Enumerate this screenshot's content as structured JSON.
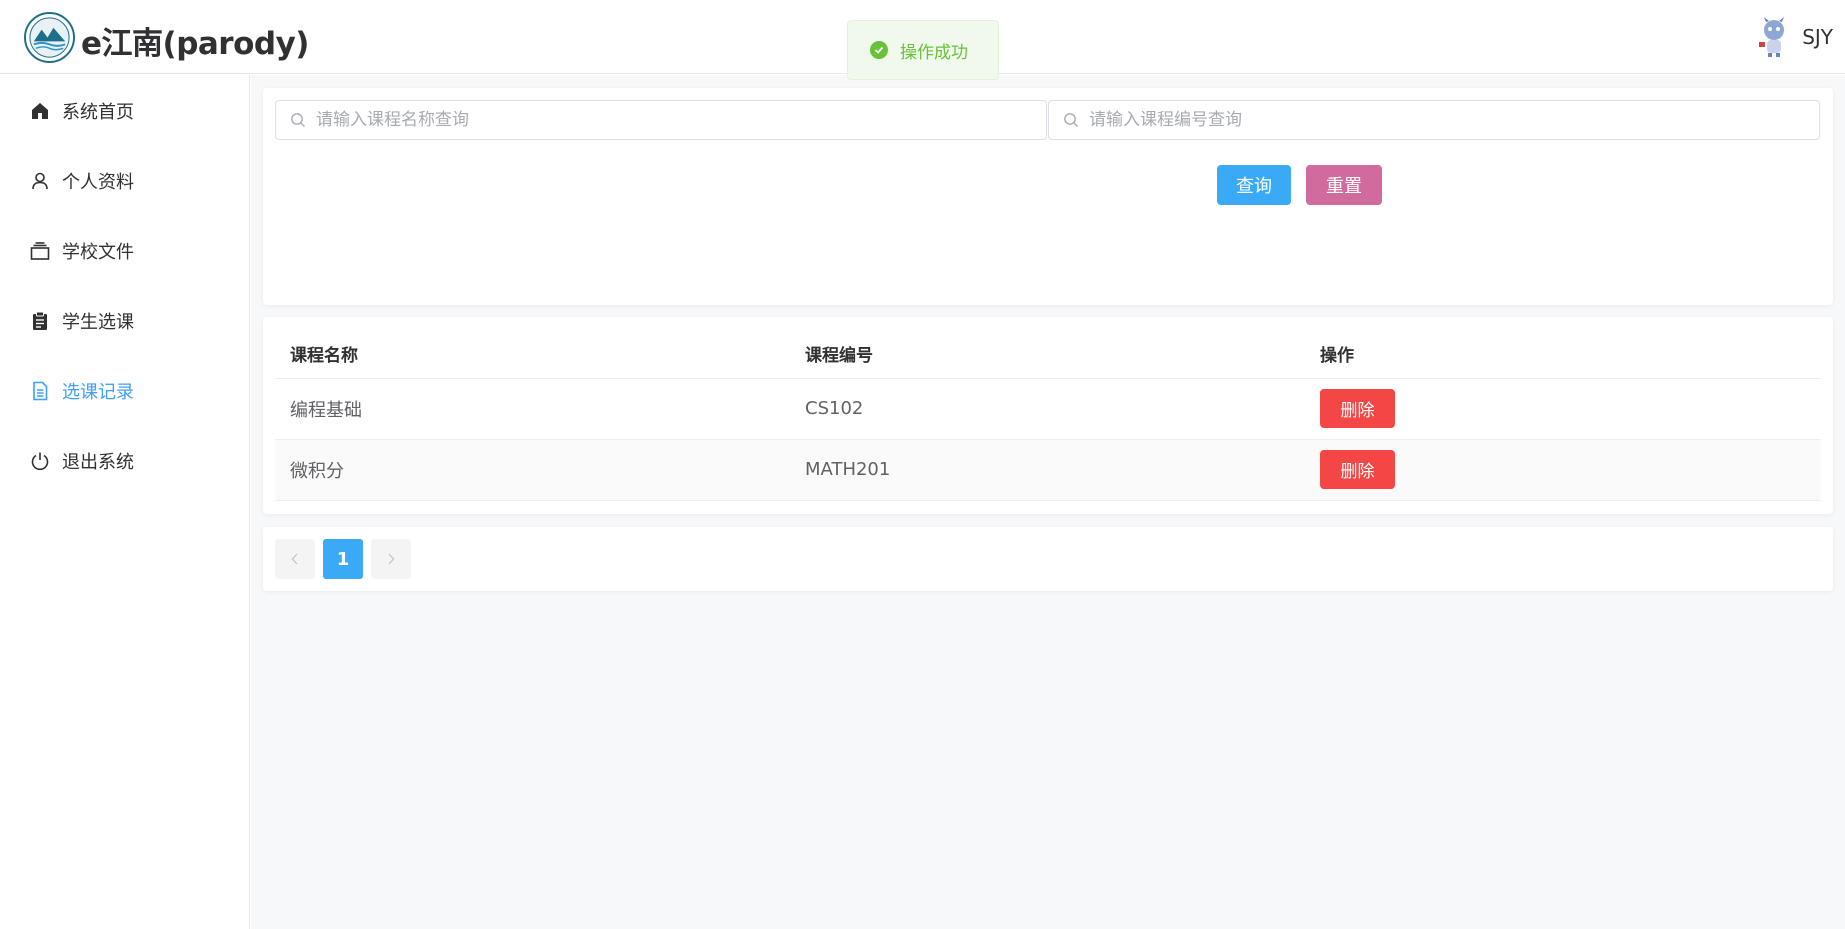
{
  "header": {
    "title": "e江南(parody)",
    "user_name": "SJY"
  },
  "toast": {
    "message": "操作成功",
    "color": "#67c23a"
  },
  "sidebar": {
    "items": [
      {
        "label": "系统首页",
        "icon": "home-icon",
        "active": false
      },
      {
        "label": "个人资料",
        "icon": "user-icon",
        "active": false
      },
      {
        "label": "学校文件",
        "icon": "files-icon",
        "active": false
      },
      {
        "label": "学生选课",
        "icon": "clipboard-icon",
        "active": false
      },
      {
        "label": "选课记录",
        "icon": "document-icon",
        "active": true
      },
      {
        "label": "退出系统",
        "icon": "power-icon",
        "active": false
      }
    ],
    "active_color": "#409eff"
  },
  "search": {
    "course_name_placeholder": "请输入课程名称查询",
    "course_code_placeholder": "请输入课程编号查询",
    "query_label": "查询",
    "reset_label": "重置"
  },
  "table": {
    "headers": [
      "课程名称",
      "课程编号",
      "操作"
    ],
    "rows": [
      {
        "name": "编程基础",
        "code": "CS102",
        "action": "删除"
      },
      {
        "name": "微积分",
        "code": "MATH201",
        "action": "删除"
      }
    ]
  },
  "pagination": {
    "prev_icon": "chevron-left-icon",
    "current_page": "1",
    "next_icon": "chevron-right-icon"
  },
  "colors": {
    "primary_button": "#3aaaf6",
    "reset_button": "#d16b9e",
    "delete_button": "#f54646"
  }
}
